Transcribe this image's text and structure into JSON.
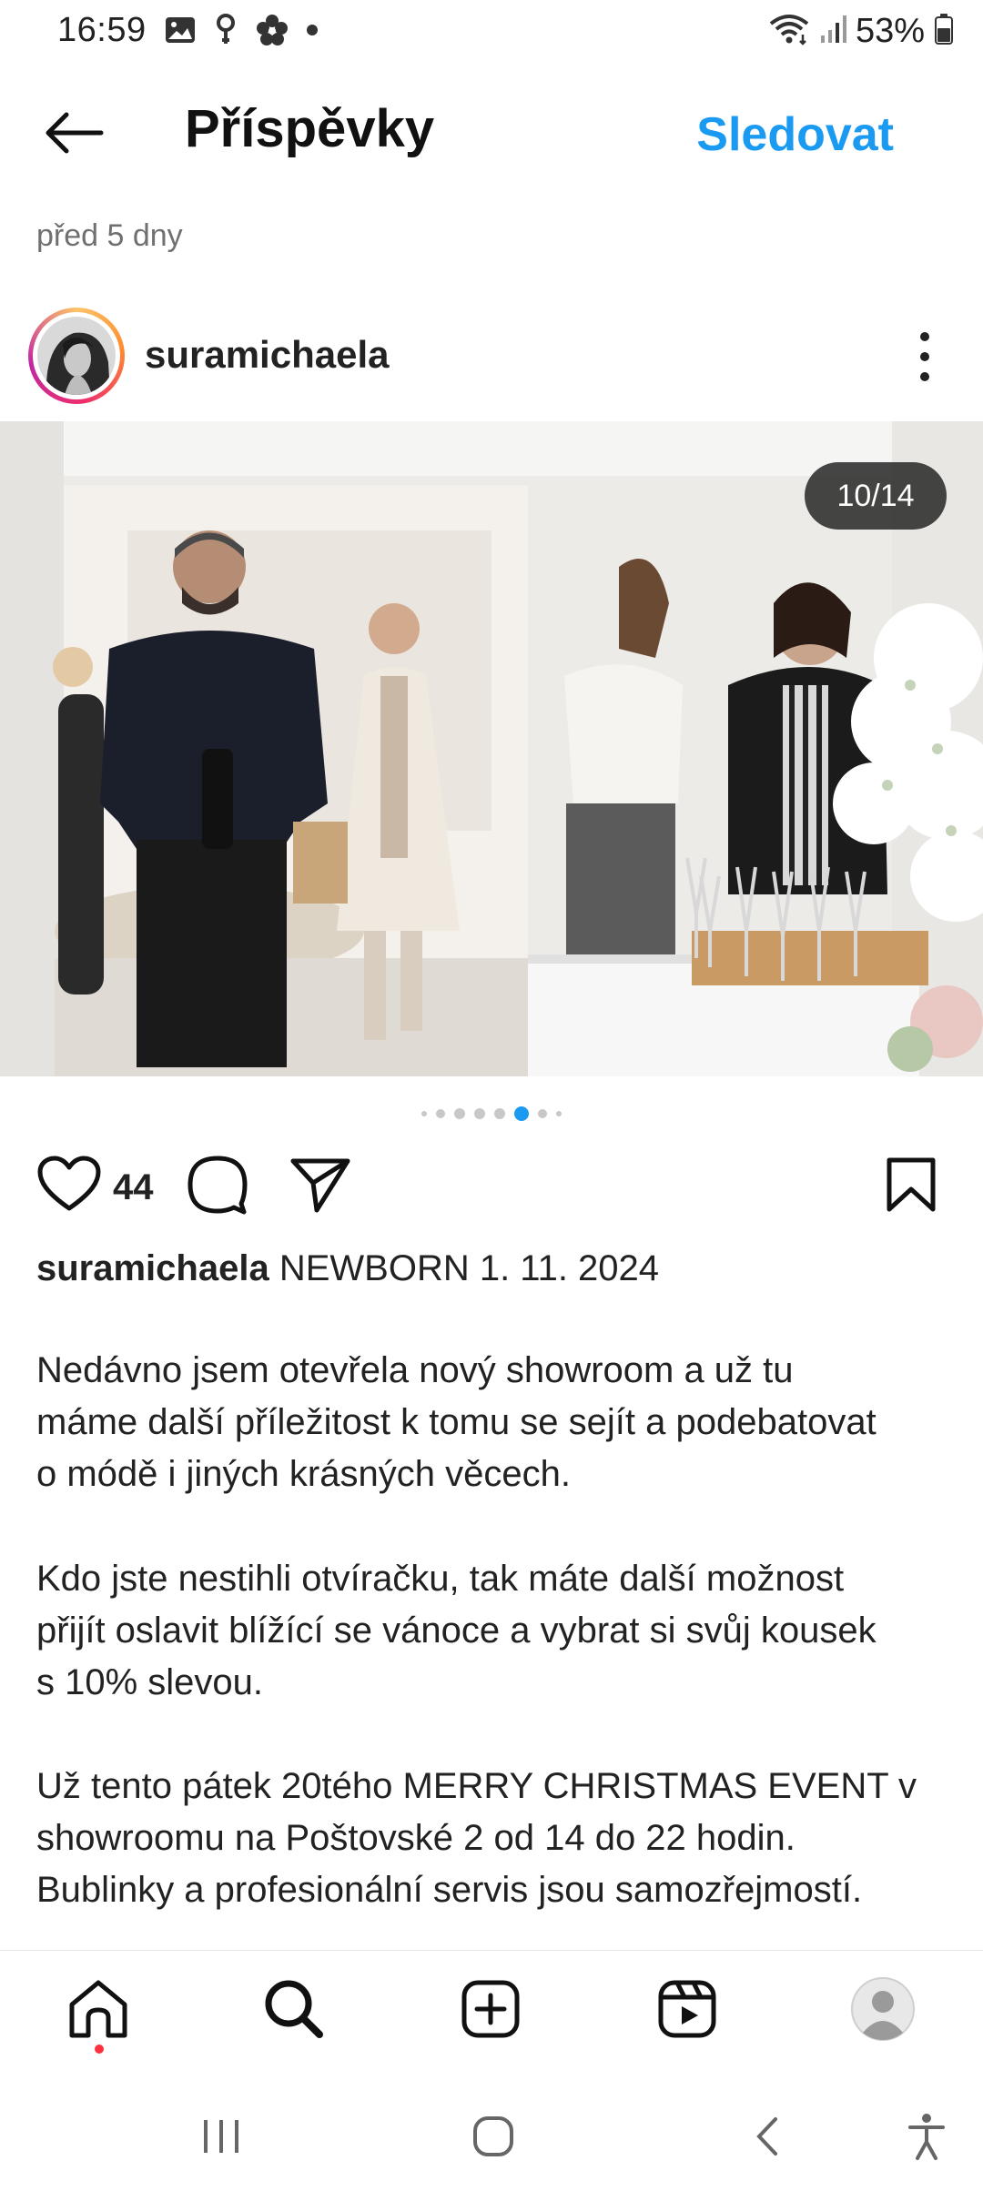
{
  "status_bar": {
    "time": "16:59",
    "battery": "53%",
    "icons": [
      "image-icon",
      "location-icon",
      "flower-icon",
      "dot-icon",
      "wifi-icon",
      "signal-icon",
      "battery-icon"
    ]
  },
  "header": {
    "title": "Příspěvky",
    "follow_label": "Sledovat",
    "back_icon": "arrow-left-icon"
  },
  "post": {
    "time_ago": "před 5 dny",
    "username": "suramichaela",
    "counter": "10/14",
    "carousel": {
      "total_dots": 8,
      "active_index": 5
    },
    "likes": "44",
    "caption": {
      "username": "suramichaela",
      "headline": "NEWBORN 1. 11. 2024",
      "p1_lines": [
        "Nedávno jsem otevřela nový showroom a už tu",
        "máme další příležitost k tomu se sejít a podebatovat",
        "o módě i jiných krásných věcech."
      ],
      "p2_lines": [
        "Kdo jste nestihli otvíračku, tak máte další možnost",
        "přijít oslavit blížící se vánoce a vybrat si svůj kousek",
        "s 10% slevou."
      ],
      "p3_lines": [
        "Už tento pátek 20tého MERRY CHRISTMAS EVENT v",
        "showroomu na Poštovské 2 od 14 do 22 hodin.",
        "Bublinky a profesionální servis jsou samozřejmostí."
      ]
    }
  },
  "bottom_nav": [
    "home-icon",
    "search-icon",
    "create-icon",
    "reels-icon",
    "profile-icon"
  ],
  "system_nav": [
    "recents-icon",
    "home-circle-icon",
    "back-icon",
    "accessibility-icon"
  ],
  "colors": {
    "accent": "#1b9af1",
    "notification": "#ff3040"
  }
}
